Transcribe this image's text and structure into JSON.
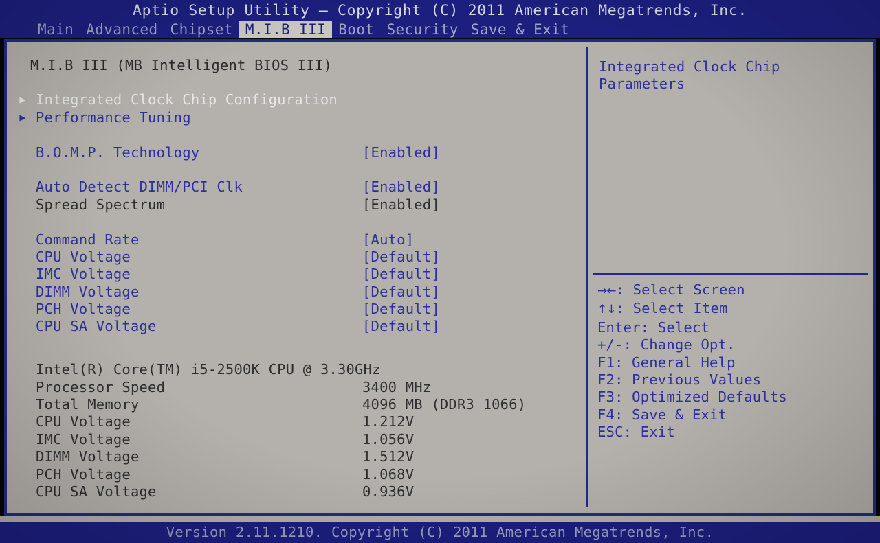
{
  "titlebar": {
    "title": "Aptio Setup Utility – Copyright (C) 2011 American Megatrends, Inc.",
    "tabs": [
      {
        "label": "Main",
        "selected": false
      },
      {
        "label": "Advanced",
        "selected": false
      },
      {
        "label": "Chipset",
        "selected": false
      },
      {
        "label": "M.I.B III",
        "selected": true
      },
      {
        "label": "Boot",
        "selected": false
      },
      {
        "label": "Security",
        "selected": false
      },
      {
        "label": "Save & Exit",
        "selected": false
      }
    ]
  },
  "main": {
    "heading": "M.I.B III (MB Intelligent BIOS III)",
    "submenus": [
      {
        "label": "Integrated Clock Chip Configuration",
        "selected": true
      },
      {
        "label": "Performance Tuning",
        "selected": false
      }
    ],
    "settings": [
      {
        "label": "B.O.M.P. Technology",
        "value": "[Enabled]",
        "state": "active"
      },
      {
        "label": "Auto Detect DIMM/PCI Clk",
        "value": "[Enabled]",
        "state": "active"
      },
      {
        "label": "Spread Spectrum",
        "value": "[Enabled]",
        "state": "disabled"
      },
      {
        "label": "Command Rate",
        "value": "[Auto]",
        "state": "active"
      },
      {
        "label": "CPU Voltage",
        "value": "[Default]",
        "state": "active"
      },
      {
        "label": "IMC Voltage",
        "value": "[Default]",
        "state": "active"
      },
      {
        "label": "DIMM Voltage",
        "value": "[Default]",
        "state": "active"
      },
      {
        "label": "PCH Voltage",
        "value": "[Default]",
        "state": "active"
      },
      {
        "label": "CPU SA Voltage",
        "value": "[Default]",
        "state": "active"
      }
    ],
    "info": {
      "cpu_name": "Intel(R) Core(TM) i5-2500K CPU @ 3.30GHz",
      "items": [
        {
          "label": "Processor Speed",
          "value": "3400 MHz"
        },
        {
          "label": "Total Memory",
          "value": "4096 MB (DDR3 1066)"
        },
        {
          "label": "CPU Voltage",
          "value": "1.212V"
        },
        {
          "label": "IMC Voltage",
          "value": "1.056V"
        },
        {
          "label": "DIMM Voltage",
          "value": "1.512V"
        },
        {
          "label": "PCH Voltage",
          "value": "1.068V"
        },
        {
          "label": "CPU SA Voltage",
          "value": "0.936V"
        }
      ]
    }
  },
  "help": {
    "description_line1": "Integrated Clock Chip",
    "description_line2": "Parameters",
    "keys": [
      {
        "glyph": "→←",
        "text": ": Select Screen"
      },
      {
        "glyph": "↑↓",
        "text": ": Select Item"
      },
      {
        "glyph": "",
        "text": "Enter: Select"
      },
      {
        "glyph": "",
        "text": "+/-: Change Opt."
      },
      {
        "glyph": "",
        "text": "F1: General Help"
      },
      {
        "glyph": "",
        "text": "F2: Previous Values"
      },
      {
        "glyph": "",
        "text": "F3: Optimized Defaults"
      },
      {
        "glyph": "",
        "text": "F4: Save & Exit"
      },
      {
        "glyph": "",
        "text": "ESC: Exit"
      }
    ]
  },
  "footer": {
    "version": "Version 2.11.1210. Copyright (C) 2011 American Megatrends, Inc."
  },
  "colors": {
    "bar_blue": "#1c1f7e",
    "border_blue": "#232a86",
    "text_blue": "#2b2fa0",
    "panel_gray": "#b4b0ab",
    "dim_text": "#2e2e30",
    "selected_text": "#e6e6e6",
    "tab_selected_bg": "#c9c5c0"
  }
}
